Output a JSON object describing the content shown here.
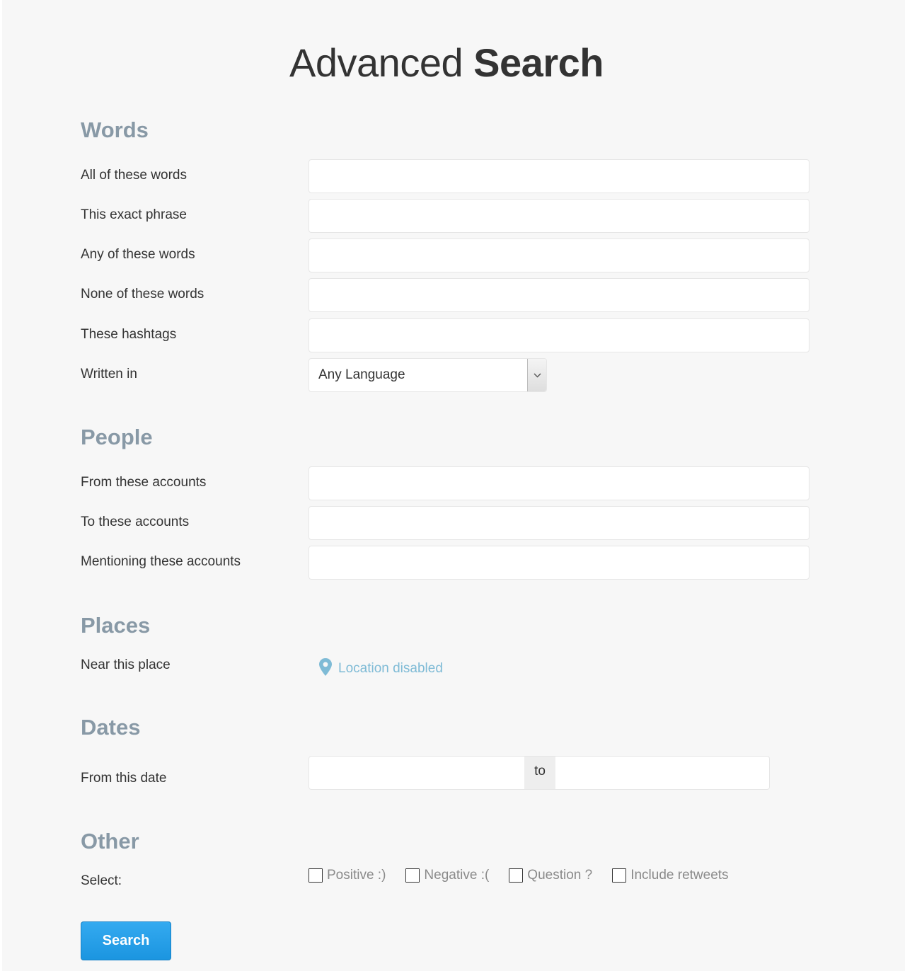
{
  "title": {
    "light": "Advanced",
    "bold": "Search"
  },
  "sections": {
    "words": "Words",
    "people": "People",
    "places": "Places",
    "dates": "Dates",
    "other": "Other"
  },
  "words": {
    "all_label": "All of these words",
    "all_value": "",
    "exact_label": "This exact phrase",
    "exact_value": "",
    "any_label": "Any of these words",
    "any_value": "",
    "none_label": "None of these words",
    "none_value": "",
    "hashtags_label": "These hashtags",
    "hashtags_value": "",
    "language_label": "Written in",
    "language_value": "Any Language"
  },
  "people": {
    "from_label": "From these accounts",
    "from_value": "",
    "to_label": "To these accounts",
    "to_value": "",
    "mentioning_label": "Mentioning these accounts",
    "mentioning_value": ""
  },
  "places": {
    "near_label": "Near this place",
    "location_text": "Location disabled",
    "location_icon": "map-pin-icon",
    "location_color": "#7fbbd6"
  },
  "dates": {
    "from_label": "From this date",
    "from_value": "",
    "to_text": "to",
    "to_value": ""
  },
  "other": {
    "select_label": "Select:",
    "options": [
      {
        "label": "Positive :)",
        "checked": false
      },
      {
        "label": "Negative :(",
        "checked": false
      },
      {
        "label": "Question ?",
        "checked": false
      },
      {
        "label": "Include retweets",
        "checked": false
      }
    ]
  },
  "search_button": "Search",
  "colors": {
    "heading": "#8899a6",
    "button": "#1da1f2",
    "background": "#f7f7f7"
  }
}
